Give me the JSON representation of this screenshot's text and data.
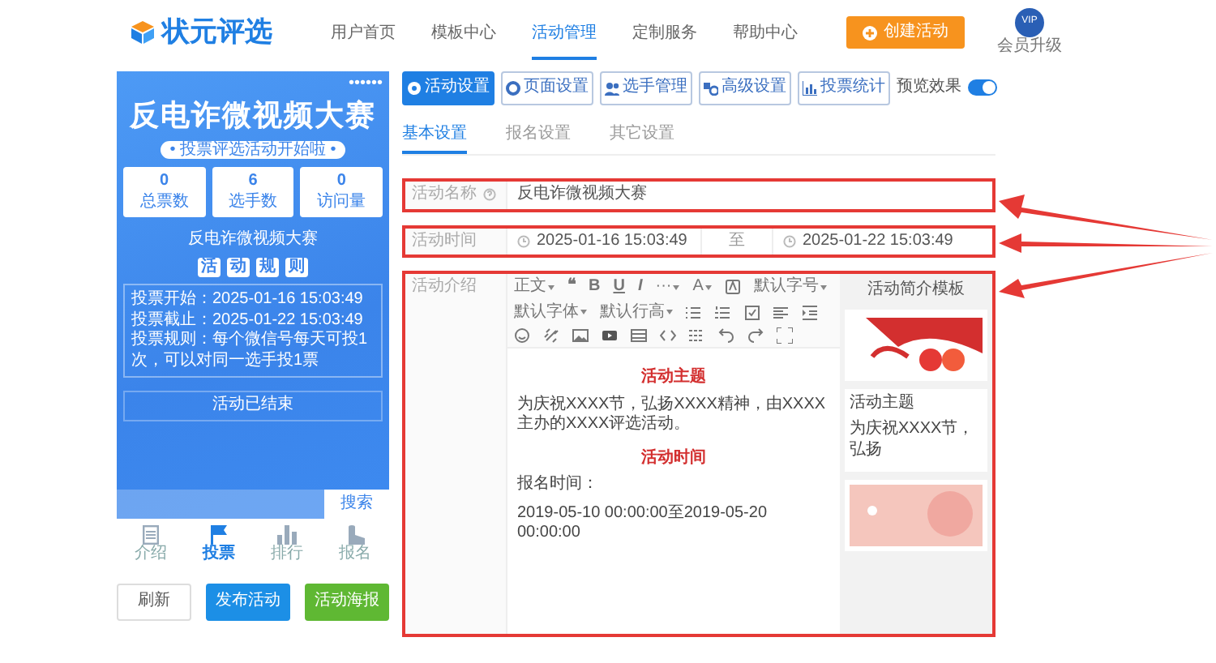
{
  "header": {
    "logo": "状元评选",
    "nav": [
      {
        "label": "用户首页",
        "selected": false
      },
      {
        "label": "模板中心",
        "selected": false
      },
      {
        "label": "活动管理",
        "selected": true
      },
      {
        "label": "定制服务",
        "selected": false
      },
      {
        "label": "帮助中心",
        "selected": false
      }
    ],
    "create_button": "创建活动",
    "vip_badge": "VIP",
    "member": "会员升级"
  },
  "preview": {
    "more": "••••••",
    "title": "反电诈微视频大赛",
    "tagline": "• 投票评选活动开始啦 •",
    "stats": [
      {
        "value": "0",
        "label": "总票数"
      },
      {
        "value": "6",
        "label": "选手数"
      },
      {
        "value": "0",
        "label": "访问量"
      }
    ],
    "name": "反电诈微视频大赛",
    "rules_title": [
      "活",
      "动",
      "规",
      "则"
    ],
    "rules": [
      {
        "label": "投票开始：",
        "value": "2025-01-16 15:03:49"
      },
      {
        "label": "投票截止：",
        "value": "2025-01-22 15:03:49"
      },
      {
        "label": "投票规则：",
        "value": "每个微信号每天可投1次，可以对同一选手投1票"
      }
    ],
    "status": "活动已结束",
    "search_button": "搜索",
    "tabs": [
      {
        "label": "介绍",
        "selected": false
      },
      {
        "label": "投票",
        "selected": true
      },
      {
        "label": "排行",
        "selected": false
      },
      {
        "label": "报名",
        "selected": false
      }
    ]
  },
  "preview_actions": [
    {
      "label": "刷新",
      "kind": "outline"
    },
    {
      "label": "发布活动",
      "kind": "primary"
    },
    {
      "label": "活动海报",
      "kind": "success"
    }
  ],
  "settings": {
    "buttons": [
      {
        "label": "活动设置",
        "selected": true
      },
      {
        "label": "页面设置",
        "selected": false
      },
      {
        "label": "选手管理",
        "selected": false
      },
      {
        "label": "高级设置",
        "selected": false
      },
      {
        "label": "投票统计",
        "selected": false
      }
    ],
    "preview_toggle": {
      "label": "预览效果",
      "on": true
    },
    "tabs": [
      {
        "label": "基本设置",
        "selected": true
      },
      {
        "label": "报名设置",
        "selected": false
      },
      {
        "label": "其它设置",
        "selected": false
      }
    ],
    "name_row": {
      "label": "活动名称",
      "value": "反电诈微视频大赛",
      "highlighted": true
    },
    "time_row": {
      "label": "活动时间",
      "start": "2025-01-16 15:03:49",
      "separator": "至",
      "end": "2025-01-22 15:03:49",
      "highlighted": true
    },
    "intro_row": {
      "label": "活动介绍",
      "highlighted": true,
      "toolbar": [
        {
          "kind": "menu",
          "label": "正文"
        },
        {
          "kind": "glyph",
          "label": "❝"
        },
        {
          "kind": "glyph",
          "label": "B"
        },
        {
          "kind": "glyph",
          "label": "U"
        },
        {
          "kind": "glyph",
          "label": "I"
        },
        {
          "kind": "menu",
          "label": "···"
        },
        {
          "kind": "menu",
          "label": "A"
        },
        {
          "kind": "icon"
        },
        {
          "kind": "menu",
          "label": "默认字号"
        },
        {
          "kind": "menu",
          "label": "默认字体"
        },
        {
          "kind": "menu",
          "label": "默认行高"
        },
        {
          "kind": "icon"
        },
        {
          "kind": "icon"
        },
        {
          "kind": "icon"
        },
        {
          "kind": "icon"
        },
        {
          "kind": "icon"
        },
        {
          "kind": "icon"
        },
        {
          "kind": "icon"
        },
        {
          "kind": "icon"
        },
        {
          "kind": "icon"
        },
        {
          "kind": "icon"
        },
        {
          "kind": "icon"
        },
        {
          "kind": "icon"
        },
        {
          "kind": "icon"
        },
        {
          "kind": "icon"
        },
        {
          "kind": "icon"
        }
      ],
      "content": [
        {
          "kind": "heading",
          "text": "活动主题"
        },
        {
          "kind": "paragraph",
          "text": "为庆祝XXXX节，弘扬XXXX精神，由XXXX主办的XXXX评选活动。"
        },
        {
          "kind": "heading",
          "text": "活动时间"
        },
        {
          "kind": "paragraph",
          "text": "报名时间："
        },
        {
          "kind": "paragraph",
          "text": "2019-05-10 00:00:00至2019-05-20 00:00:00"
        }
      ],
      "templates": {
        "title": "活动简介模板",
        "cards": [
          {
            "kind": "banner"
          },
          {
            "kind": "text",
            "lines": [
              "活动主题",
              "为庆祝XXXX节，弘扬"
            ]
          },
          {
            "kind": "illustration"
          }
        ]
      }
    }
  }
}
